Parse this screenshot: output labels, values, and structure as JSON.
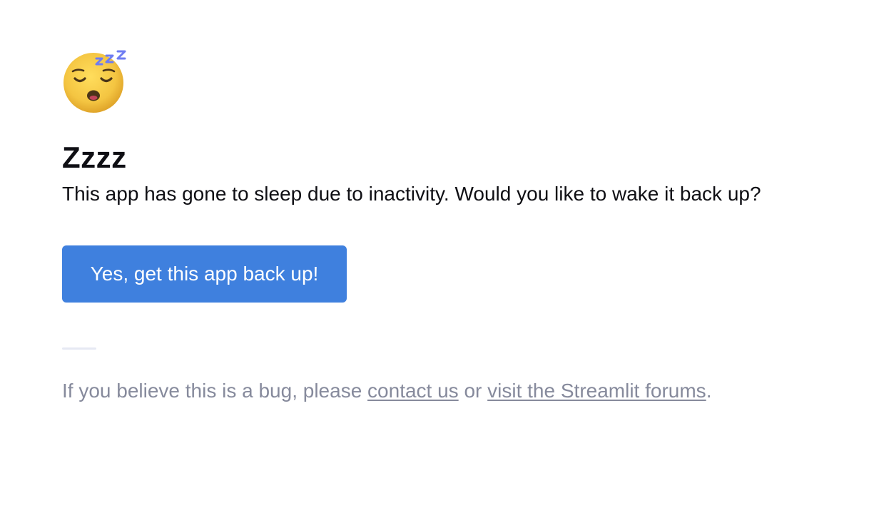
{
  "icon": {
    "name": "sleeping-face-icon"
  },
  "heading": {
    "title": "Zzzz"
  },
  "message": {
    "text": "This app has gone to sleep due to inactivity. Would you like to wake it back up?"
  },
  "action": {
    "wake_button_label": "Yes, get this app back up!"
  },
  "footer": {
    "prefix": "If you believe this is a bug, please ",
    "contact_link": "contact us",
    "middle": " or ",
    "forum_link": "visit the Streamlit forums",
    "suffix": "."
  },
  "colors": {
    "button_background": "#3f80de",
    "button_text": "#ffffff",
    "footer_text": "#868a9c",
    "divider": "#e6e9f3",
    "emoji_face": "#f4c542",
    "zzz": "#6e7cf2"
  }
}
